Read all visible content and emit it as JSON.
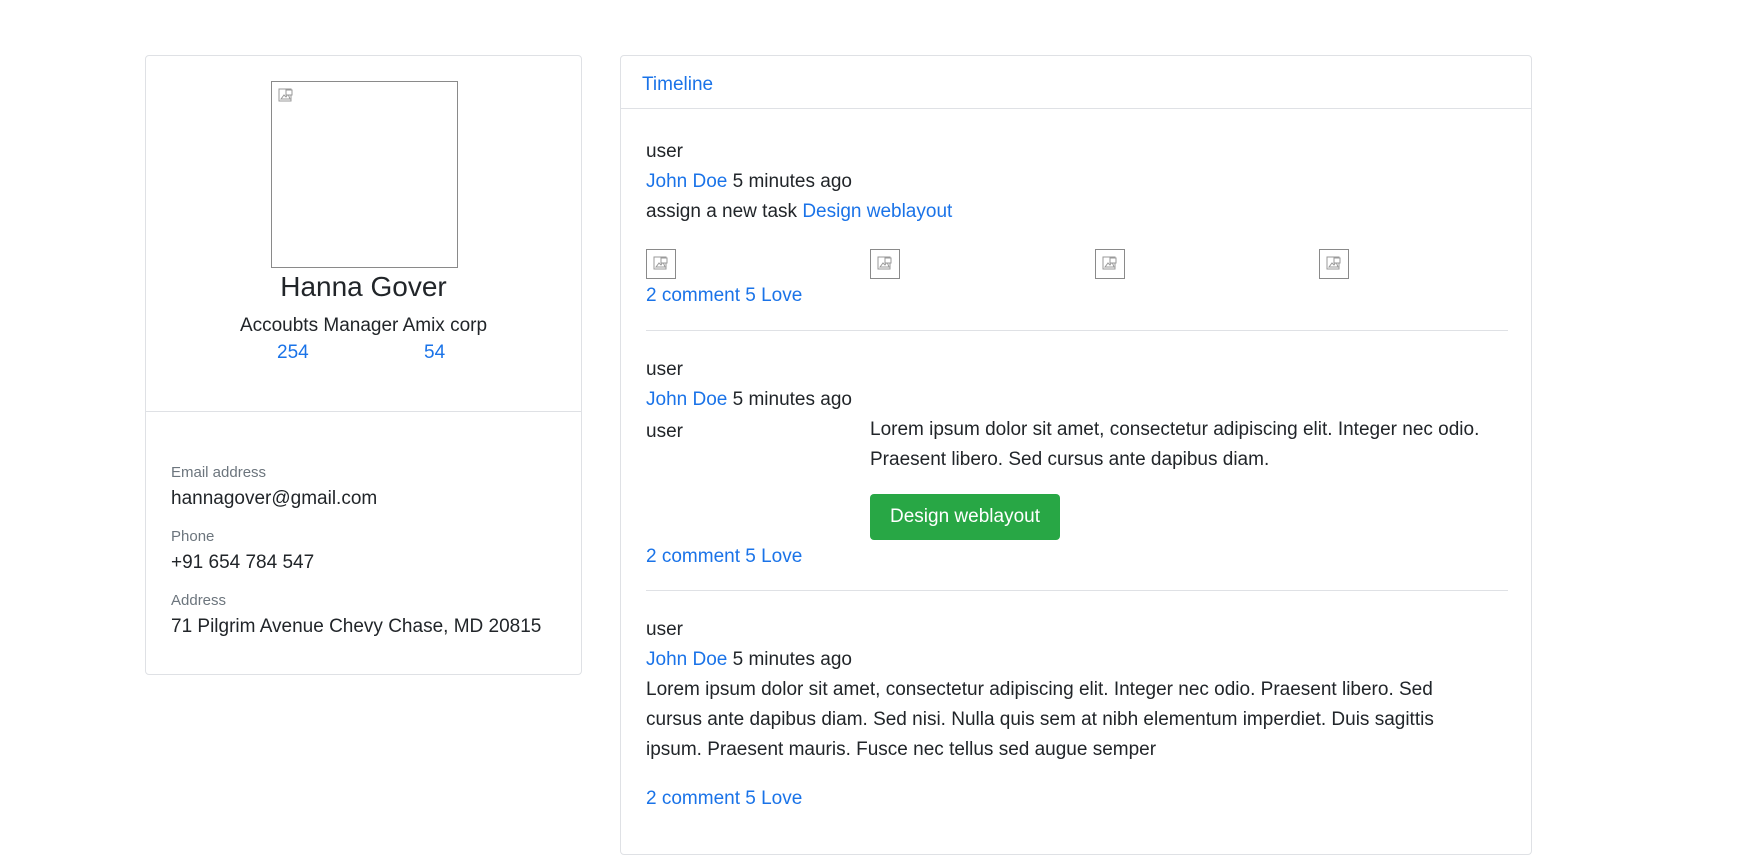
{
  "profile": {
    "name": "Hanna Gover",
    "role": "Accoubts Manager Amix corp",
    "stats": [
      "254",
      "54"
    ],
    "email_label": "Email address",
    "email": "hannagover@gmail.com",
    "phone_label": "Phone",
    "phone": "+91 654 784 547",
    "address_label": "Address",
    "address": "71 Pilgrim Avenue Chevy Chase, MD 20815"
  },
  "timeline": {
    "tab_label": "Timeline",
    "posts": [
      {
        "user_alt": "user",
        "author": "John Doe",
        "time": "5 minutes ago",
        "action_text": "assign a new task",
        "action_link": "Design weblayout",
        "footer": "2 comment 5 Love"
      },
      {
        "user_alt": "user",
        "author": "John Doe",
        "time": "5 minutes ago",
        "image_alt": "user",
        "body": "Lorem ipsum dolor sit amet, consectetur adipiscing elit. Integer nec odio. Praesent libero. Sed cursus ante dapibus diam.",
        "button_label": "Design weblayout",
        "footer": "2 comment 5 Love"
      },
      {
        "user_alt": "user",
        "author": "John Doe",
        "time": "5 minutes ago",
        "body": "Lorem ipsum dolor sit amet, consectetur adipiscing elit. Integer nec odio. Praesent libero. Sed cursus ante dapibus diam. Sed nisi. Nulla quis sem at nibh elementum imperdiet. Duis sagittis ipsum. Praesent mauris. Fusce nec tellus sed augue semper",
        "footer": "2 comment 5 Love"
      }
    ]
  },
  "colors": {
    "link": "#1a73e8",
    "button_green": "#28a745",
    "border": "#dfe1e5"
  }
}
